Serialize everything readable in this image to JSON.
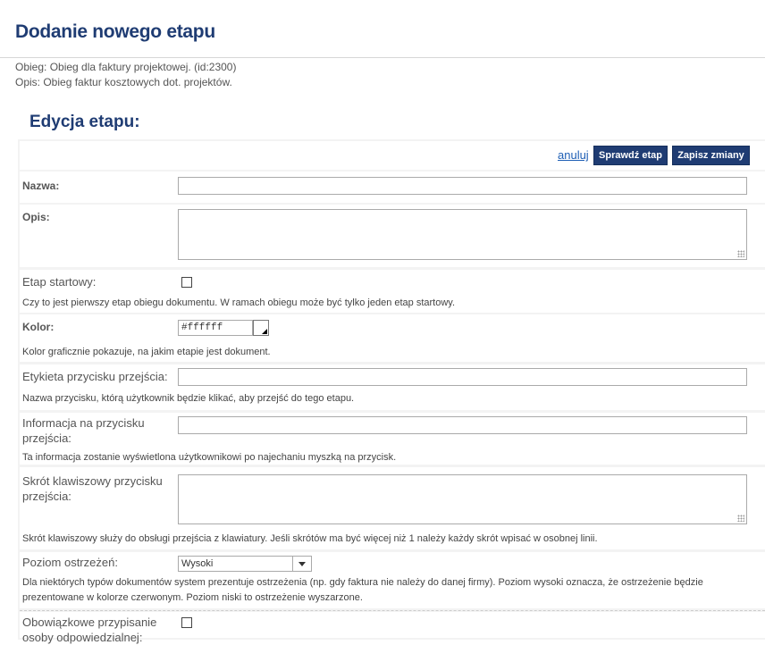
{
  "page": {
    "title": "Dodanie nowego etapu",
    "info_line1": "Obieg: Obieg dla faktury projektowej.  (id:2300)",
    "info_line2": "Opis: Obieg faktur kosztowych dot. projektów."
  },
  "section": {
    "title": "Edycja etapu:"
  },
  "toolbar": {
    "cancel_label": "anuluj",
    "check_label": "Sprawdź etap",
    "save_label": "Zapisz zmiany"
  },
  "form": {
    "name": {
      "label": "Nazwa:",
      "value": ""
    },
    "description": {
      "label": "Opis:",
      "value": ""
    },
    "start_stage": {
      "label": "Etap startowy:",
      "checked": false,
      "help": "Czy to jest pierwszy etap obiegu dokumentu. W ramach obiegu może być tylko jeden etap startowy."
    },
    "color": {
      "label": "Kolor:",
      "value": "#ffffff",
      "help": "Kolor graficznie pokazuje, na jakim etapie jest dokument."
    },
    "button_label": {
      "label": "Etykieta przycisku przejścia:",
      "value": "",
      "help": "Nazwa przycisku, którą użytkownik będzie klikać, aby przejść do tego etapu."
    },
    "button_info": {
      "label_line1": "Informacja na przycisku",
      "label_line2": "przejścia:",
      "value": "",
      "help": "Ta informacja zostanie wyświetlona użytkownikowi po najechaniu myszką na przycisk."
    },
    "shortcut": {
      "label_line1": "Skrót klawiszowy przycisku",
      "label_line2": "przejścia:",
      "value": "",
      "help": "Skrót klawiszowy służy do obsługi przejścia z klawiatury. Jeśli skrótów ma być więcej niż 1 należy każdy skrót wpisać w osobnej linii."
    },
    "warning_level": {
      "label": "Poziom ostrzeżeń:",
      "selected": "Wysoki",
      "help_line1": "Dla niektórych typów dokumentów system prezentuje ostrzeżenia (np. gdy faktura nie należy do danej firmy). Poziom wysoki oznacza, że ostrzeżenie będzie",
      "help_line2": "prezentowane w kolorze czerwonym. Poziom niski to ostrzeżenie wyszarzone."
    },
    "mandatory_assign": {
      "label_line1": "Obowiązkowe przypisanie",
      "label_line2": "osoby odpowiedzialnej:",
      "checked": false
    }
  },
  "colors": {
    "brand": "#1f3c73",
    "link": "#1f5fb5",
    "panel": "#f3f3f3"
  }
}
